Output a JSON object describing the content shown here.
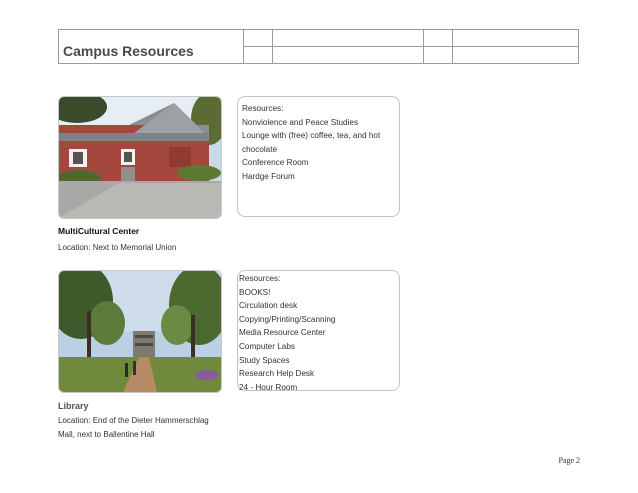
{
  "header": {
    "title": "Campus Resources"
  },
  "sections": [
    {
      "name": "MultiCultural Center",
      "location": "Location: Next to Memorial Union",
      "resources": [
        "Resources:",
        "Nonviolence and Peace Studies",
        "Lounge with (free) coffee, tea, and hot",
        "chocolate",
        "Conference Room",
        "Hardge Forum"
      ]
    },
    {
      "name": "Library",
      "location_lines": [
        "Location: End of the Dieter Hammerschlag",
        "Mall, next to Ballentine Hall"
      ],
      "resources": [
        "Resources:",
        "BOOKS!",
        "Circulation desk",
        "Copying/Printing/Scanning",
        "Media Resource Center",
        "Computer Labs",
        "Study Spaces",
        "Research Help Desk",
        "24 - Hour Room"
      ]
    }
  ],
  "footer": {
    "page": "Page 2"
  }
}
